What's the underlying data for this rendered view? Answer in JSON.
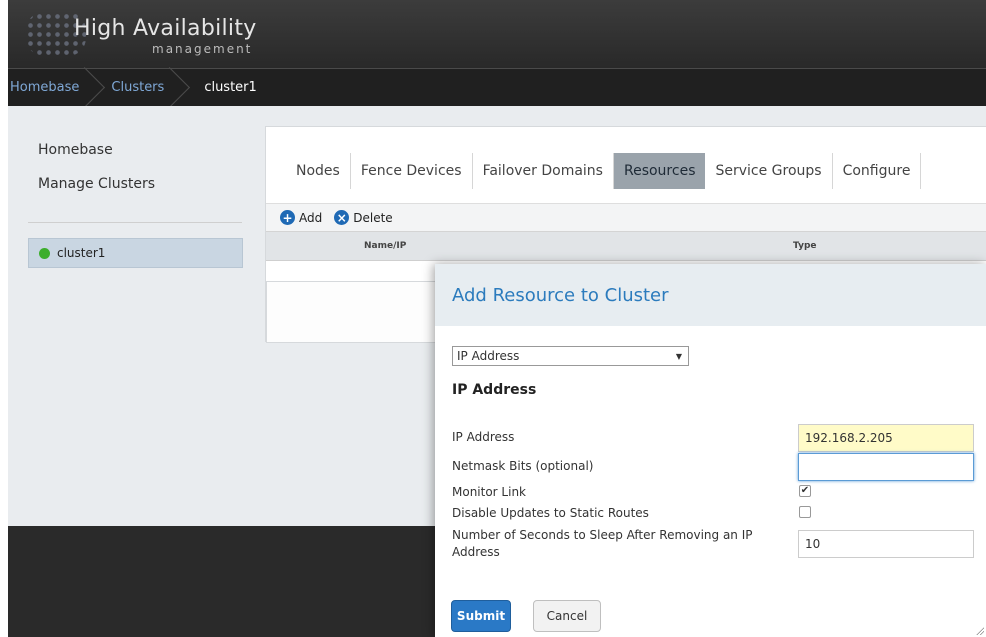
{
  "header": {
    "title": "High Availability",
    "subtitle": "management"
  },
  "breadcrumb": [
    "Homebase",
    "Clusters",
    "cluster1"
  ],
  "sidebar": {
    "links": [
      "Homebase",
      "Manage Clusters"
    ],
    "clusters": [
      {
        "name": "cluster1",
        "status_color": "#3cae2c"
      }
    ]
  },
  "tabs": [
    "Nodes",
    "Fence Devices",
    "Failover Domains",
    "Resources",
    "Service Groups",
    "Configure"
  ],
  "active_tab": "Resources",
  "toolbar": {
    "add_label": "Add",
    "delete_label": "Delete"
  },
  "table": {
    "columns": [
      "Name/IP",
      "Type"
    ]
  },
  "modal": {
    "title": "Add Resource to Cluster",
    "resource_type": "IP Address",
    "section_title": "IP Address",
    "fields": {
      "ip_address": {
        "label": "IP Address",
        "value": "192.168.2.205"
      },
      "netmask_bits": {
        "label": "Netmask Bits (optional)",
        "value": ""
      },
      "monitor_link": {
        "label": "Monitor Link",
        "checked": true,
        "mark": "✔"
      },
      "disable_updates": {
        "label": "Disable Updates to Static Routes",
        "checked": false
      },
      "sleep_seconds": {
        "label": "Number of Seconds to Sleep After Removing an IP Address",
        "value": "10"
      }
    },
    "submit_label": "Submit",
    "cancel_label": "Cancel"
  },
  "colors": {
    "accent": "#2a79c6",
    "title_blue": "#2b7bbd",
    "status_ok": "#3cae2c"
  }
}
